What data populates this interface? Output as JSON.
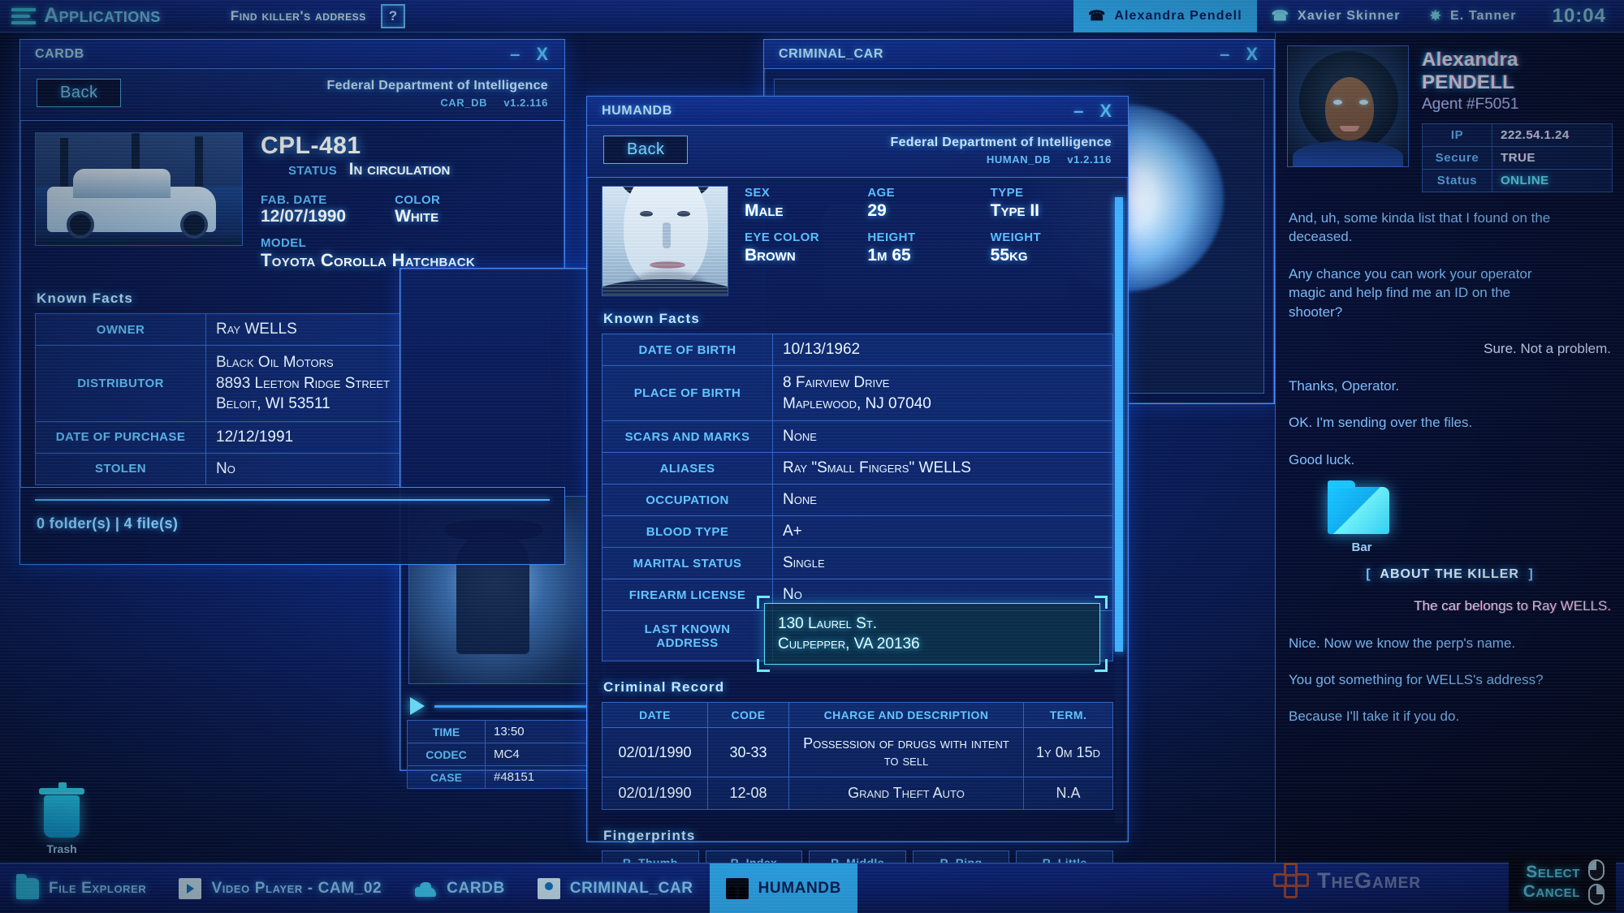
{
  "topbar": {
    "menu_label": "Applications",
    "objective": "Find killer's address",
    "help_label": "?",
    "contacts": [
      {
        "name": "Alexandra Pendell",
        "icon": "phone-icon",
        "active": true
      },
      {
        "name": "Xavier Skinner",
        "icon": "phone-icon",
        "active": false
      },
      {
        "name": "E. Tanner",
        "icon": "badge-icon",
        "active": false
      }
    ],
    "clock": "10:04"
  },
  "cardb": {
    "title": "CARDB",
    "minimize": "–",
    "close": "X",
    "back_label": "Back",
    "org_line1": "Federal Department of Intelligence",
    "org_db": "CAR_DB",
    "org_version": "v1.2.116",
    "plate": "CPL-481",
    "status_label": "Status",
    "status_value": "In circulation",
    "fab_date_label": "Fab. date",
    "fab_date_value": "12/07/1990",
    "color_label": "Color",
    "color_value": "White",
    "model_label": "Model",
    "model_value": "Toyota Corolla Hatchback",
    "known_facts_title": "Known  Facts",
    "facts": [
      {
        "key": "Owner",
        "value": "Ray WELLS"
      },
      {
        "key": "Distributor",
        "value": "Black Oil Motors\n8893 Leeton Ridge Street\nBeloit, WI 53511"
      },
      {
        "key": "Date of purchase",
        "value": "12/12/1991"
      },
      {
        "key": "Stolen",
        "value": "No"
      }
    ]
  },
  "file_explorer": {
    "count_text": "0 folder(s)   |   4 file(s)"
  },
  "video_player": {
    "play_icon": "play-icon",
    "rows": [
      {
        "key": "Time",
        "value": "13:50"
      },
      {
        "key": "Codec",
        "value": "MC4"
      },
      {
        "key": "Case",
        "value": "#48151"
      }
    ]
  },
  "criminal_car": {
    "title": "CRIMINAL_CAR",
    "minimize": "–",
    "close": "X"
  },
  "humandb": {
    "title": "HUMANDB",
    "minimize": "–",
    "close": "X",
    "back_label": "Back",
    "org_line1": "Federal Department of Intelligence",
    "org_db": "HUMAN_DB",
    "org_version": "v1.2.116",
    "sex_label": "Sex",
    "sex_value": "Male",
    "age_label": "Age",
    "age_value": "29",
    "type_label": "Type",
    "type_value": "Type II",
    "eye_color_label": "Eye color",
    "eye_color_value": "Brown",
    "height_label": "Height",
    "height_value": "1m 65",
    "weight_label": "Weight",
    "weight_value": "55kg",
    "known_facts_title": "Known  Facts",
    "facts": [
      {
        "key": "Date of birth",
        "value": "10/13/1962"
      },
      {
        "key": "Place of birth",
        "value": "8 Fairview Drive\nMaplewood, NJ 07040"
      },
      {
        "key": "Scars and marks",
        "value": "None"
      },
      {
        "key": "Aliases",
        "value": "Ray \"Small Fingers\" WELLS"
      },
      {
        "key": "Occupation",
        "value": "None"
      },
      {
        "key": "Blood type",
        "value": "A+"
      },
      {
        "key": "Marital status",
        "value": "Single"
      },
      {
        "key": "Firearm license",
        "value": "No"
      },
      {
        "key": "Last known address",
        "value": ""
      }
    ],
    "last_known_address": {
      "line1": "130 Laurel St.",
      "line2": "Culpepper, VA 20136"
    },
    "criminal_record_title": "Criminal  Record",
    "criminal_columns": [
      "Date",
      "Code",
      "Charge and description",
      "Term."
    ],
    "criminal_rows": [
      {
        "date": "02/01/1990",
        "code": "30-33",
        "charge": "Possession of drugs with intent to sell",
        "term": "1y 0m 15d"
      },
      {
        "date": "02/01/1990",
        "code": "12-08",
        "charge": "Grand Theft Auto",
        "term": "N.A"
      }
    ],
    "fingerprints_title": "Fingerprints",
    "fingerprint_labels": [
      "R. Thumb",
      "R. Index",
      "R. Middle",
      "R. Ring",
      "R. Little"
    ]
  },
  "sidebar": {
    "agent_name": "Alexandra PENDELL",
    "agent_id": "Agent #F5051",
    "stats": [
      {
        "key": "IP",
        "value": "222.54.1.24",
        "online": false
      },
      {
        "key": "Secure",
        "value": "TRUE",
        "online": false
      },
      {
        "key": "Status",
        "value": "ONLINE",
        "online": true
      }
    ],
    "messages": [
      {
        "text": "And, uh, some kinda list that I found on the deceased.",
        "side": "left"
      },
      {
        "text": "Any chance you can work your operator magic and help find me an ID on the shooter?",
        "side": "left"
      },
      {
        "text": "Sure. Not a problem.",
        "side": "right"
      },
      {
        "text": "Thanks, Operator.",
        "side": "left"
      },
      {
        "text": "OK. I'm sending over the files.",
        "side": "left"
      },
      {
        "text": "Good luck.",
        "side": "left"
      }
    ],
    "attachment": {
      "name": "Bar",
      "icon": "folder-icon"
    },
    "topic_divider": "ABOUT THE KILLER",
    "topic_bracket_left": "[",
    "topic_bracket_right": "]",
    "messages2": [
      {
        "text": "The car belongs to Ray WELLS.",
        "side": "right"
      },
      {
        "text": "Nice. Now we know the perp's name.",
        "side": "left"
      },
      {
        "text": "You got something for WELLS's address?",
        "side": "left"
      },
      {
        "text": "Because I'll take it if you do.",
        "side": "left"
      }
    ]
  },
  "desktop": {
    "trash_label": "Trash",
    "trash_icon": "trash-icon"
  },
  "taskbar": {
    "items": [
      {
        "label": "File Explorer",
        "icon": "folder-icon",
        "active": false
      },
      {
        "label": "Video Player - CAM_02",
        "icon": "video-icon",
        "active": false
      },
      {
        "label": "CARDB",
        "icon": "car-icon",
        "active": false
      },
      {
        "label": "CRIMINAL_CAR",
        "icon": "document-icon",
        "active": false
      },
      {
        "label": "HUMANDB",
        "icon": "human-icon",
        "active": true
      }
    ]
  },
  "prompts": {
    "select": "Select",
    "cancel": "Cancel",
    "watermark": "TheGamer"
  }
}
